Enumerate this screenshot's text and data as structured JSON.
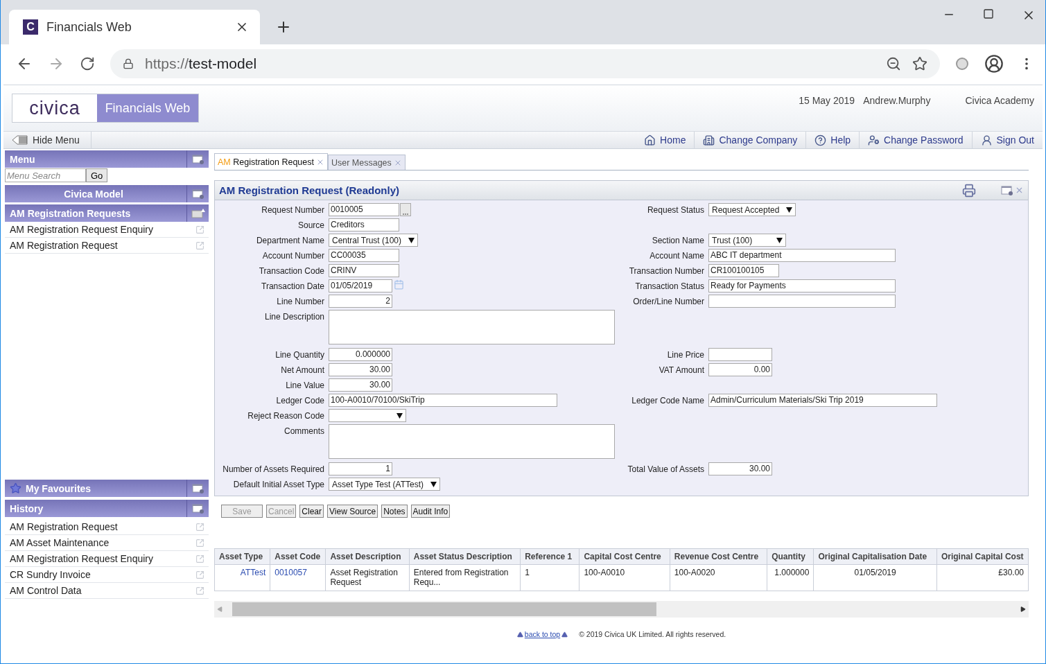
{
  "browser": {
    "favicon": "C",
    "tab_title": "Financials Web",
    "url": {
      "scheme": "https://",
      "host": "test-model"
    }
  },
  "header": {
    "logo": "civica",
    "product": "Financials Web",
    "date": "15 May 2019",
    "user": "Andrew.Murphy",
    "company": "Civica Academy"
  },
  "toolbar": {
    "hide_menu": "Hide Menu",
    "links": [
      "Home",
      "Change Company",
      "Help",
      "Change Password",
      "Sign Out"
    ]
  },
  "sidebar": {
    "menu_title": "Menu",
    "search_placeholder": "Menu Search",
    "go": "Go",
    "group": "Civica Model",
    "section": "AM Registration Requests",
    "items": [
      {
        "label": "AM Registration Request Enquiry"
      },
      {
        "label": "AM Registration Request"
      }
    ],
    "favourites_title": "My Favourites",
    "history_title": "History",
    "history": [
      {
        "label": "AM Registration Request"
      },
      {
        "label": "AM Asset Maintenance"
      },
      {
        "label": "AM Registration Request Enquiry"
      },
      {
        "label": "CR Sundry Invoice"
      },
      {
        "label": "AM Control Data"
      }
    ]
  },
  "tabs": [
    {
      "prefix": "AM",
      "label": "Registration Request",
      "selected": true
    },
    {
      "label": "User Messages",
      "selected": false
    }
  ],
  "form": {
    "title": "AM Registration Request (Readonly)",
    "rows": [
      {
        "left": {
          "label": "Request Number",
          "kind": "lookup",
          "value": "0010005"
        },
        "right": {
          "label": "Request Status",
          "kind": "select",
          "value": "Request Accepted"
        }
      },
      {
        "left": {
          "label": "Source",
          "kind": "text",
          "value": "Creditors"
        }
      },
      {
        "left": {
          "label": "Department Name",
          "kind": "select",
          "value": "Central Trust (100)"
        },
        "right": {
          "label": "Section Name",
          "kind": "select",
          "value": "Trust (100)"
        }
      },
      {
        "left": {
          "label": "Account Number",
          "kind": "text",
          "value": "CC00035"
        },
        "right": {
          "label": "Account Name",
          "kind": "wide",
          "value": "ABC IT department"
        }
      },
      {
        "left": {
          "label": "Transaction Code",
          "kind": "text",
          "value": "CRINV"
        },
        "right": {
          "label": "Transaction Number",
          "kind": "text",
          "value": "CR100100105"
        }
      },
      {
        "left": {
          "label": "Transaction Date",
          "kind": "date",
          "value": "01/05/2019"
        },
        "right": {
          "label": "Transaction Status",
          "kind": "wide",
          "value": "Ready for Payments"
        }
      },
      {
        "left": {
          "label": "Line Number",
          "kind": "number",
          "value": "2"
        },
        "right": {
          "label": "Order/Line Number",
          "kind": "wide"
        }
      },
      {
        "left": {
          "label": "Line Description",
          "kind": "textarea"
        }
      },
      {
        "left": {
          "label": "Line Quantity",
          "kind": "number",
          "value": "0.000000"
        },
        "right": {
          "label": "Line Price",
          "kind": "number"
        }
      },
      {
        "left": {
          "label": "Net Amount",
          "kind": "number",
          "value": "30.00"
        },
        "right": {
          "label": "VAT Amount",
          "kind": "number",
          "value": "0.00"
        }
      },
      {
        "left": {
          "label": "Line Value",
          "kind": "number",
          "value": "30.00"
        }
      },
      {
        "left": {
          "label": "Ledger Code",
          "kind": "wide",
          "value": "100-A0010/70100/SkiTrip"
        },
        "right": {
          "label": "Ledger Code Name",
          "kind": "wide",
          "value": "Admin/Curriculum Materials/Ski Trip 2019"
        }
      },
      {
        "left": {
          "label": "Reject Reason Code",
          "kind": "select"
        }
      },
      {
        "left": {
          "label": "Comments",
          "kind": "textarea"
        }
      },
      {
        "left": {
          "label": "Number of Assets Required",
          "kind": "number",
          "value": "1"
        },
        "right": {
          "label": "Total Value of Assets",
          "kind": "number",
          "value": "30.00"
        }
      },
      {
        "left": {
          "label": "Default Initial Asset Type",
          "kind": "select",
          "value": "Asset Type Test (ATTest)"
        }
      }
    ],
    "buttons": [
      {
        "label": "Save",
        "disabled": true
      },
      {
        "label": "Cancel",
        "disabled": true
      },
      {
        "label": "Clear",
        "disabled": false
      },
      {
        "label": "View Source",
        "disabled": false
      },
      {
        "label": "Notes",
        "disabled": false
      },
      {
        "label": "Audit Info",
        "disabled": false
      }
    ]
  },
  "table": {
    "columns": [
      "Asset Type",
      "Asset Code",
      "Asset Description",
      "Asset Status Description",
      "Reference 1",
      "Capital Cost Centre",
      "Revenue Cost Centre",
      "Quantity",
      "Original Capitalisation Date",
      "Original Capital Cost"
    ],
    "rows": [
      [
        {
          "text": "ATTest",
          "kind": "link"
        },
        {
          "text": "0010057",
          "kind": "link"
        },
        {
          "text": "Asset Registration Request",
          "kind": "text"
        },
        {
          "text": "Entered from Registration Requ...",
          "kind": "text"
        },
        {
          "text": "1",
          "kind": "text"
        },
        {
          "text": "100-A0010",
          "kind": "text"
        },
        {
          "text": "100-A0020",
          "kind": "text"
        },
        {
          "text": "1.000000",
          "kind": "text"
        },
        {
          "text": "01/05/2019",
          "kind": "date"
        },
        {
          "text": "£30.00",
          "kind": "number"
        }
      ]
    ]
  },
  "footer": {
    "back_to_top": "back to top",
    "copyright": "© 2019 Civica UK Limited. All rights reserved."
  }
}
